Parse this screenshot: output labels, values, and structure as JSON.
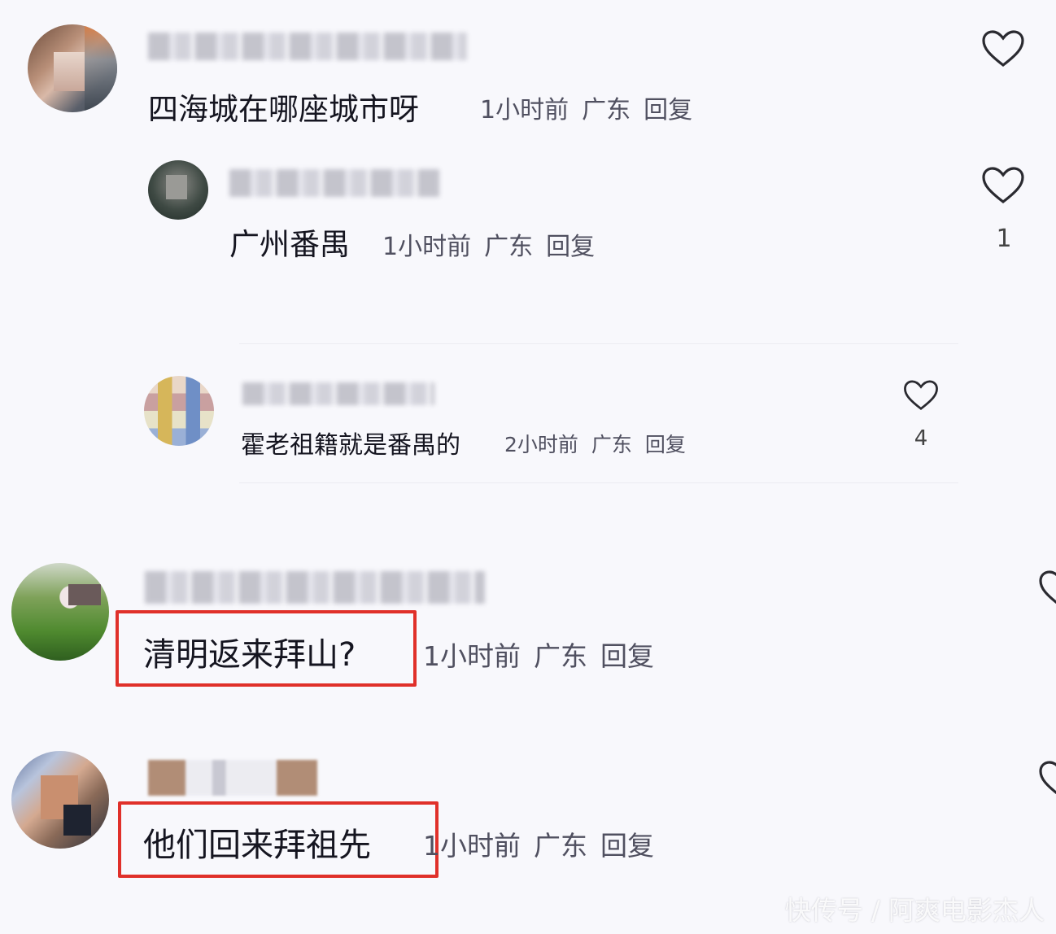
{
  "comments": [
    {
      "text": "四海城在哪座城市呀",
      "time": "1小时前",
      "location": "广东",
      "reply_label": "回复"
    },
    {
      "text": "广州番禺",
      "time": "1小时前",
      "location": "广东",
      "reply_label": "回复",
      "likes": "1"
    },
    {
      "text": "霍老祖籍就是番禺的",
      "time": "2小时前",
      "location": "广东",
      "reply_label": "回复",
      "likes": "4"
    },
    {
      "text": "清明返来拜山?",
      "time": "1小时前",
      "location": "广东",
      "reply_label": "回复"
    },
    {
      "text": "他们回来拜祖先",
      "time": "1小时前",
      "location": "广东",
      "reply_label": "回复"
    }
  ],
  "icons": {
    "like": "heart-outline-icon"
  },
  "highlight_color": "#e0302a",
  "watermark": "快传号 / 阿爽电影杰人"
}
